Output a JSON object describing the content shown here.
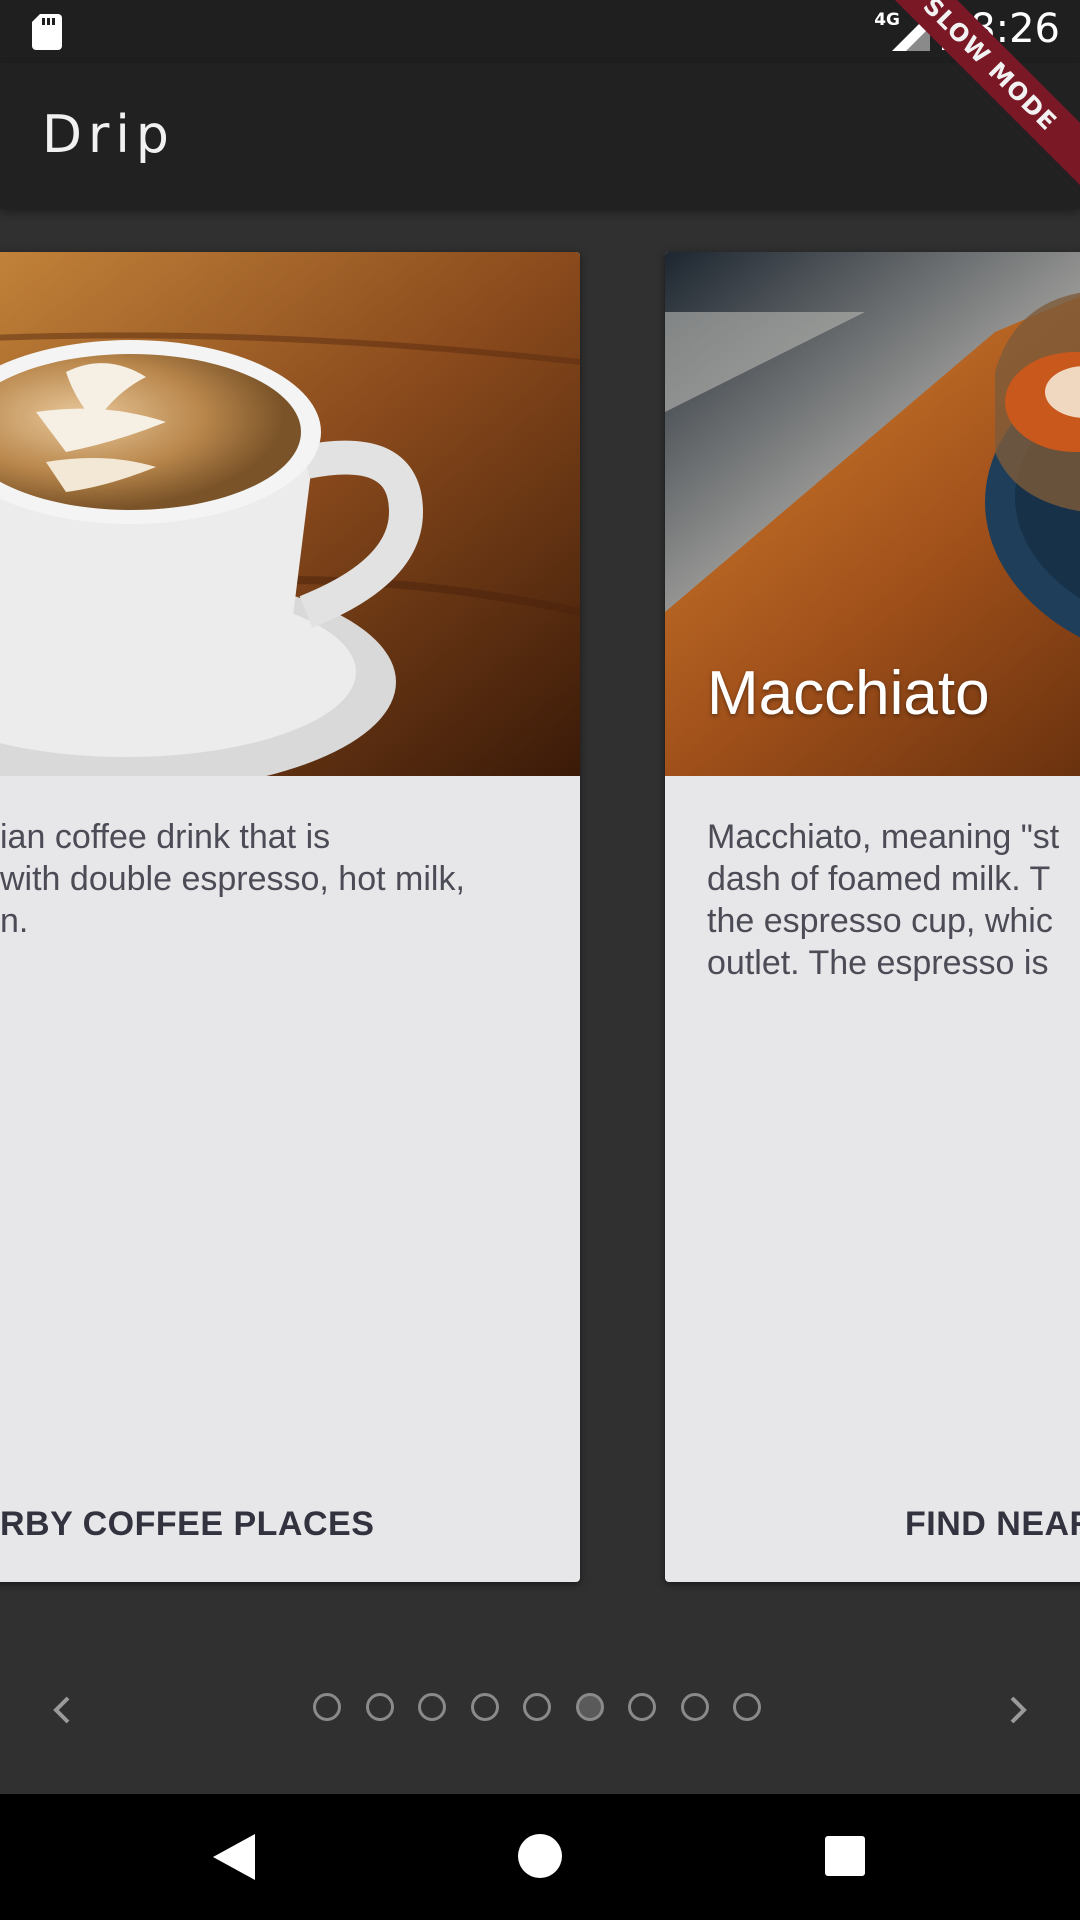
{
  "status_bar": {
    "network": "4G",
    "time": "8:26"
  },
  "debug_banner": "SLOW MODE",
  "app_bar": {
    "title": "Drip"
  },
  "cards": [
    {
      "title": "",
      "description_lines": [
        "ian coffee drink that is",
        "with double espresso, hot milk,",
        "n."
      ],
      "action_label": "RBY COFFEE PLACES",
      "image": "latte-art-cup-icon"
    },
    {
      "title": "Macchiato",
      "description_lines": [
        "Macchiato, meaning \"st",
        "dash of foamed milk. T",
        "the espresso cup, whic",
        "outlet. The espresso is"
      ],
      "action_label": "FIND NEAR",
      "image": "macchiato-glass-icon"
    }
  ],
  "pager": {
    "page_count": 9,
    "active_index": 5,
    "prev_icon": "chevron-left-icon",
    "next_icon": "chevron-right-icon"
  },
  "nav_bar": {
    "back_icon": "back-triangle-icon",
    "home_icon": "home-circle-icon",
    "recents_icon": "recents-square-icon"
  }
}
